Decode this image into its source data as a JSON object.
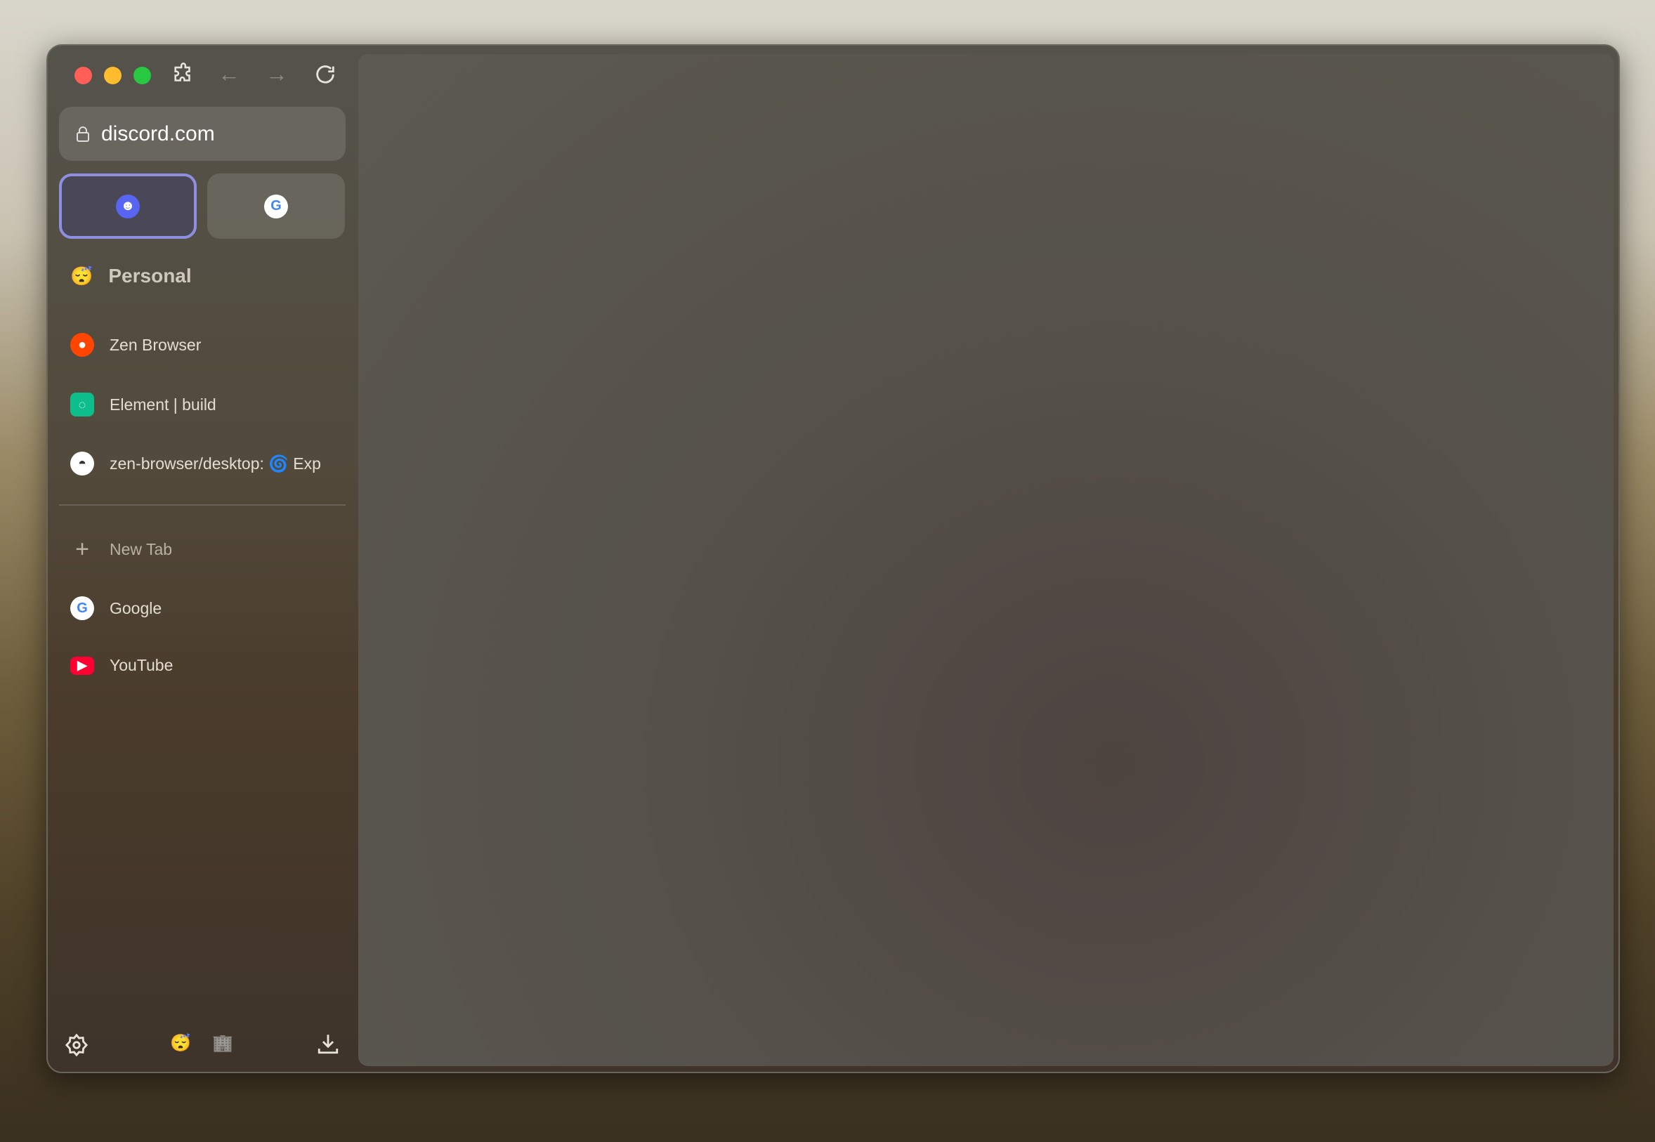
{
  "window": {
    "traffic_lights": {
      "close": "#ff5f57",
      "minimize": "#febc2e",
      "maximize": "#28c840"
    }
  },
  "toolbar": {
    "icons": [
      "puzzle-icon",
      "arrow-left-icon",
      "arrow-right-icon",
      "reload-icon"
    ]
  },
  "urlbar": {
    "value": "discord.com",
    "icon": "lock-icon"
  },
  "pinned": [
    {
      "site": "Discord",
      "selected": true,
      "color": "#5865f2"
    },
    {
      "site": "Google",
      "selected": false
    }
  ],
  "workspace": {
    "emoji": "😴",
    "name": "Personal"
  },
  "tabs": [
    {
      "label": "Zen Browser",
      "icon": "reddit-icon",
      "color": "#ff4500"
    },
    {
      "label": "Element | build",
      "icon": "element-icon",
      "color": "#0dbd8b"
    },
    {
      "label": "zen-browser/desktop: 🌀 Exp",
      "icon": "github-icon"
    }
  ],
  "new_tab": "New Tab",
  "unpinned": [
    {
      "label": "Google",
      "icon": "google-icon"
    },
    {
      "label": "YouTube",
      "icon": "youtube-icon",
      "color": "#ff0033"
    }
  ],
  "footer": {
    "workspaces": [
      "😴",
      "🏢"
    ],
    "icons": [
      "settings-icon",
      "download-icon"
    ]
  }
}
